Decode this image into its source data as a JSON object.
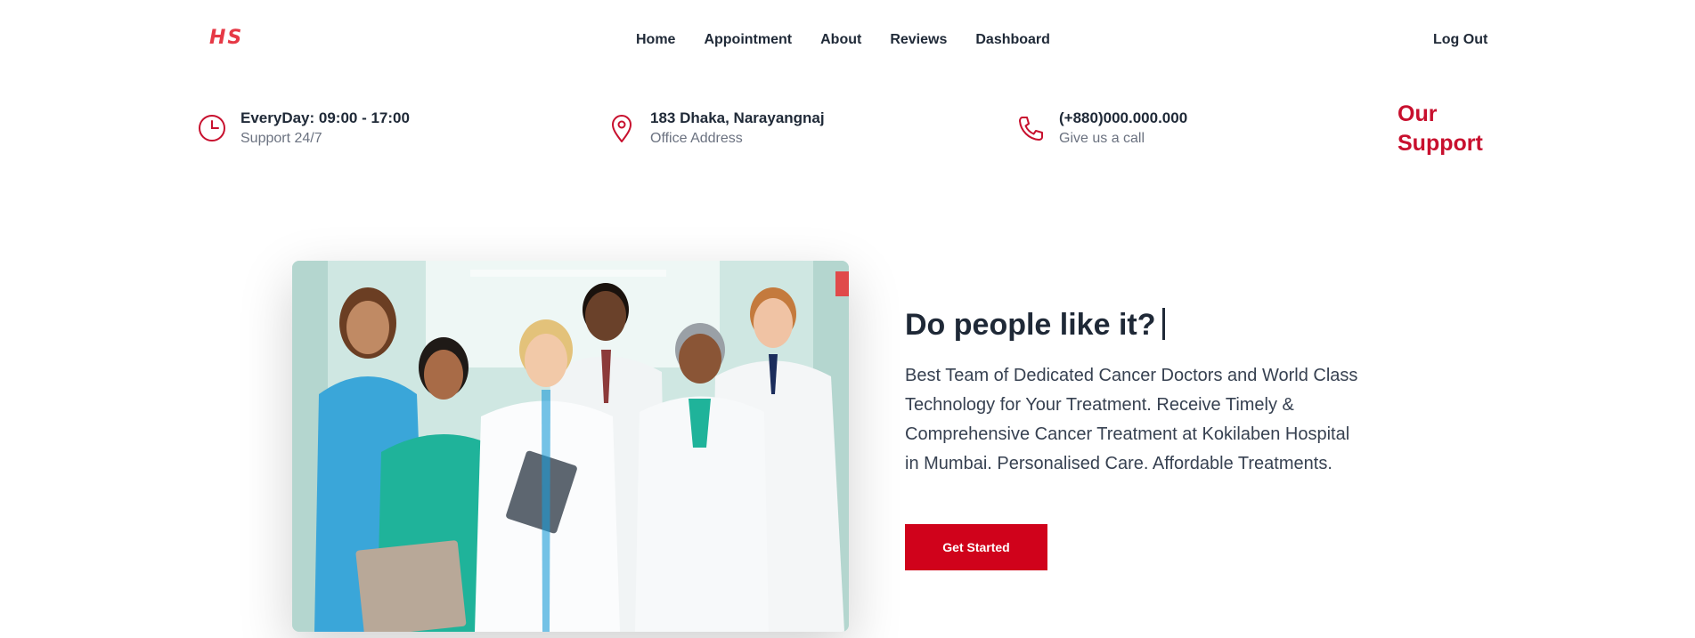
{
  "brand": {
    "logo_text": "HS",
    "accent_color": "#c8102e"
  },
  "nav": {
    "links": [
      "Home",
      "Appointment",
      "About",
      "Reviews",
      "Dashboard"
    ],
    "logout_label": "Log Out"
  },
  "info": [
    {
      "icon": "clock-icon",
      "title": "EveryDay: 09:00 - 17:00",
      "subtitle": "Support 24/7"
    },
    {
      "icon": "map-pin-icon",
      "title": "183 Dhaka, Narayangnaj",
      "subtitle": "Office Address"
    },
    {
      "icon": "phone-icon",
      "title": "(+880)000.000.000",
      "subtitle": "Give us a call"
    }
  ],
  "support": {
    "title": "Our Support"
  },
  "hero": {
    "image_alt": "doctors-team-photo",
    "heading": "Do people like it?",
    "description": "Best Team of Dedicated Cancer Doctors and World Class Technology for Your Treatment. Receive Timely & Comprehensive Cancer Treatment at Kokilaben Hospital in Mumbai. Personalised Care. Affordable Treatments.",
    "cta_label": "Get Started"
  }
}
